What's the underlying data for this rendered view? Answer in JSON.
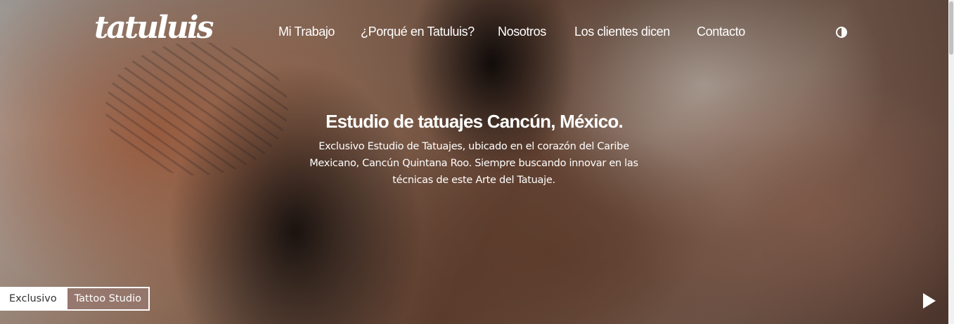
{
  "header": {
    "logo_text": "tatuluis",
    "nav": [
      {
        "label": "Mi Trabajo"
      },
      {
        "label": "¿Porqué en Tatuluis?"
      },
      {
        "label": "Nosotros"
      },
      {
        "label": "Los clientes dicen"
      },
      {
        "label": "Contacto"
      }
    ],
    "theme_toggle_icon": "contrast-icon"
  },
  "hero": {
    "title": "Estudio de tatuajes Cancún, México.",
    "description": "Exclusivo Estudio de Tatuajes, ubicado en el corazón del Caribe Mexicano, Cancún Quintana Roo. Siempre buscando innovar en las técnicas de este Arte del Tatuaje.",
    "badge_left": "Exclusivo",
    "badge_right": "Tattoo Studio",
    "play_icon": "play-icon"
  },
  "colors": {
    "text": "#ffffff",
    "badge_bg": "#ffffff",
    "badge_accent": "#96786e"
  }
}
